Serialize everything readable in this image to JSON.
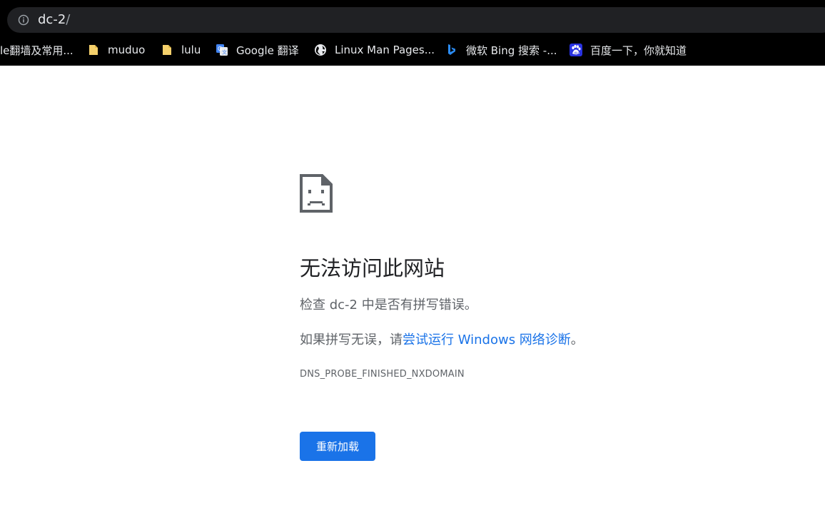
{
  "address_bar": {
    "host": "dc-2",
    "path": "/"
  },
  "bookmarks": [
    {
      "label": "le翻墙及常用...",
      "icon": "none"
    },
    {
      "label": "muduo",
      "icon": "folder-icon"
    },
    {
      "label": "lulu",
      "icon": "folder-icon"
    },
    {
      "label": "Google 翻译",
      "icon": "google-translate-icon"
    },
    {
      "label": "Linux Man Pages...",
      "icon": "globe-icon"
    },
    {
      "label": "微软 Bing 搜索 -...",
      "icon": "bing-icon"
    },
    {
      "label": "百度一下，你就知道",
      "icon": "baidu-icon"
    }
  ],
  "error": {
    "title": "无法访问此网站",
    "check_prefix": "检查 ",
    "check_host": "dc-2",
    "check_suffix": " 中是否有拼写错误。",
    "if_prefix": "如果拼写无误，请",
    "diagnostics_link": "尝试运行 Windows 网络诊断",
    "if_suffix": "。",
    "code": "DNS_PROBE_FINISHED_NXDOMAIN",
    "reload_label": "重新加载"
  },
  "colors": {
    "link": "#1a73e8",
    "button": "#1a73e8",
    "folder": "#f5d06b"
  }
}
